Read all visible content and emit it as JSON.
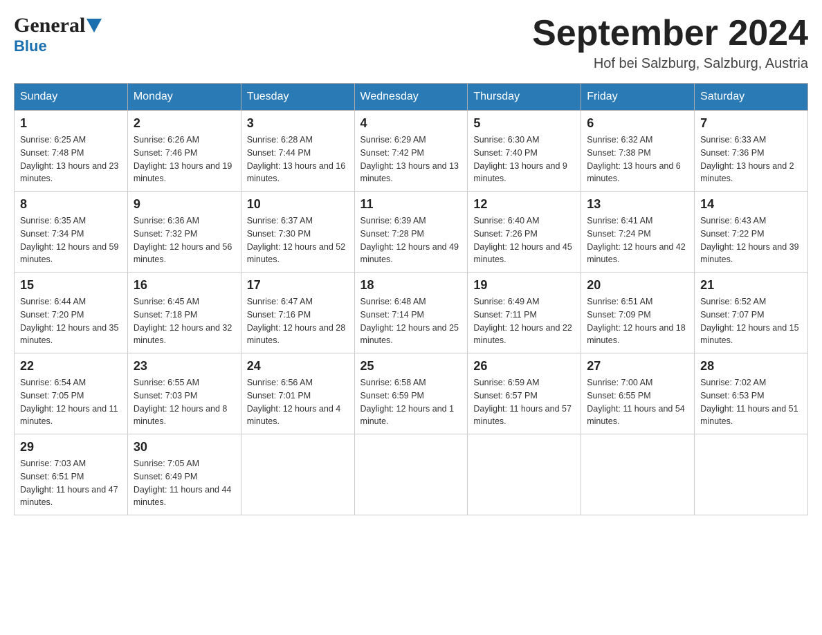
{
  "header": {
    "logo_general": "General",
    "logo_blue": "Blue",
    "month_title": "September 2024",
    "location": "Hof bei Salzburg, Salzburg, Austria"
  },
  "weekdays": [
    "Sunday",
    "Monday",
    "Tuesday",
    "Wednesday",
    "Thursday",
    "Friday",
    "Saturday"
  ],
  "weeks": [
    [
      {
        "day": "1",
        "sunrise": "6:25 AM",
        "sunset": "7:48 PM",
        "daylight": "13 hours and 23 minutes."
      },
      {
        "day": "2",
        "sunrise": "6:26 AM",
        "sunset": "7:46 PM",
        "daylight": "13 hours and 19 minutes."
      },
      {
        "day": "3",
        "sunrise": "6:28 AM",
        "sunset": "7:44 PM",
        "daylight": "13 hours and 16 minutes."
      },
      {
        "day": "4",
        "sunrise": "6:29 AM",
        "sunset": "7:42 PM",
        "daylight": "13 hours and 13 minutes."
      },
      {
        "day": "5",
        "sunrise": "6:30 AM",
        "sunset": "7:40 PM",
        "daylight": "13 hours and 9 minutes."
      },
      {
        "day": "6",
        "sunrise": "6:32 AM",
        "sunset": "7:38 PM",
        "daylight": "13 hours and 6 minutes."
      },
      {
        "day": "7",
        "sunrise": "6:33 AM",
        "sunset": "7:36 PM",
        "daylight": "13 hours and 2 minutes."
      }
    ],
    [
      {
        "day": "8",
        "sunrise": "6:35 AM",
        "sunset": "7:34 PM",
        "daylight": "12 hours and 59 minutes."
      },
      {
        "day": "9",
        "sunrise": "6:36 AM",
        "sunset": "7:32 PM",
        "daylight": "12 hours and 56 minutes."
      },
      {
        "day": "10",
        "sunrise": "6:37 AM",
        "sunset": "7:30 PM",
        "daylight": "12 hours and 52 minutes."
      },
      {
        "day": "11",
        "sunrise": "6:39 AM",
        "sunset": "7:28 PM",
        "daylight": "12 hours and 49 minutes."
      },
      {
        "day": "12",
        "sunrise": "6:40 AM",
        "sunset": "7:26 PM",
        "daylight": "12 hours and 45 minutes."
      },
      {
        "day": "13",
        "sunrise": "6:41 AM",
        "sunset": "7:24 PM",
        "daylight": "12 hours and 42 minutes."
      },
      {
        "day": "14",
        "sunrise": "6:43 AM",
        "sunset": "7:22 PM",
        "daylight": "12 hours and 39 minutes."
      }
    ],
    [
      {
        "day": "15",
        "sunrise": "6:44 AM",
        "sunset": "7:20 PM",
        "daylight": "12 hours and 35 minutes."
      },
      {
        "day": "16",
        "sunrise": "6:45 AM",
        "sunset": "7:18 PM",
        "daylight": "12 hours and 32 minutes."
      },
      {
        "day": "17",
        "sunrise": "6:47 AM",
        "sunset": "7:16 PM",
        "daylight": "12 hours and 28 minutes."
      },
      {
        "day": "18",
        "sunrise": "6:48 AM",
        "sunset": "7:14 PM",
        "daylight": "12 hours and 25 minutes."
      },
      {
        "day": "19",
        "sunrise": "6:49 AM",
        "sunset": "7:11 PM",
        "daylight": "12 hours and 22 minutes."
      },
      {
        "day": "20",
        "sunrise": "6:51 AM",
        "sunset": "7:09 PM",
        "daylight": "12 hours and 18 minutes."
      },
      {
        "day": "21",
        "sunrise": "6:52 AM",
        "sunset": "7:07 PM",
        "daylight": "12 hours and 15 minutes."
      }
    ],
    [
      {
        "day": "22",
        "sunrise": "6:54 AM",
        "sunset": "7:05 PM",
        "daylight": "12 hours and 11 minutes."
      },
      {
        "day": "23",
        "sunrise": "6:55 AM",
        "sunset": "7:03 PM",
        "daylight": "12 hours and 8 minutes."
      },
      {
        "day": "24",
        "sunrise": "6:56 AM",
        "sunset": "7:01 PM",
        "daylight": "12 hours and 4 minutes."
      },
      {
        "day": "25",
        "sunrise": "6:58 AM",
        "sunset": "6:59 PM",
        "daylight": "12 hours and 1 minute."
      },
      {
        "day": "26",
        "sunrise": "6:59 AM",
        "sunset": "6:57 PM",
        "daylight": "11 hours and 57 minutes."
      },
      {
        "day": "27",
        "sunrise": "7:00 AM",
        "sunset": "6:55 PM",
        "daylight": "11 hours and 54 minutes."
      },
      {
        "day": "28",
        "sunrise": "7:02 AM",
        "sunset": "6:53 PM",
        "daylight": "11 hours and 51 minutes."
      }
    ],
    [
      {
        "day": "29",
        "sunrise": "7:03 AM",
        "sunset": "6:51 PM",
        "daylight": "11 hours and 47 minutes."
      },
      {
        "day": "30",
        "sunrise": "7:05 AM",
        "sunset": "6:49 PM",
        "daylight": "11 hours and 44 minutes."
      },
      null,
      null,
      null,
      null,
      null
    ]
  ]
}
